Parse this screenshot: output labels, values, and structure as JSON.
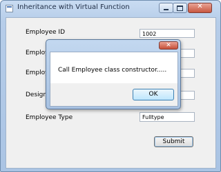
{
  "window": {
    "title": "Inheritance with Virtual Function",
    "close_glyph": "✕"
  },
  "form": {
    "fields": [
      {
        "label": "Employee ID",
        "value": "1002"
      },
      {
        "label": "Employee Name",
        "value": ""
      },
      {
        "label": "Employee Salary",
        "value": ""
      },
      {
        "label": "Designation",
        "value": ""
      },
      {
        "label": "Employee Type",
        "value": "Fulltype"
      }
    ],
    "submit_label": "Submit"
  },
  "message_box": {
    "close_glyph": "✕",
    "text": "Call Employee class constructor.....",
    "ok_label": "OK"
  }
}
